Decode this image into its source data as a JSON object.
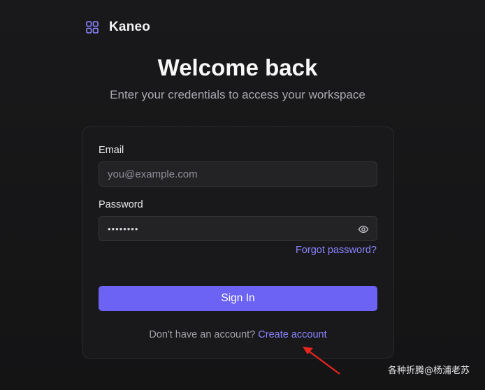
{
  "brand": {
    "name": "Kaneo",
    "icon": "grid-icon"
  },
  "header": {
    "title": "Welcome back",
    "subtitle": "Enter your credentials to access your workspace"
  },
  "form": {
    "email_label": "Email",
    "email_placeholder": "you@example.com",
    "password_label": "Password",
    "password_value": "••••••••",
    "forgot_label": "Forgot password?",
    "submit_label": "Sign In",
    "signup_prompt": "Don't have an account?",
    "signup_link": "Create account"
  },
  "watermark": "各种折腾@杨浦老苏",
  "colors": {
    "accent": "#6c62f3",
    "link": "#8b84ff",
    "background": "#161617",
    "annotation_arrow": "#e8241f"
  }
}
